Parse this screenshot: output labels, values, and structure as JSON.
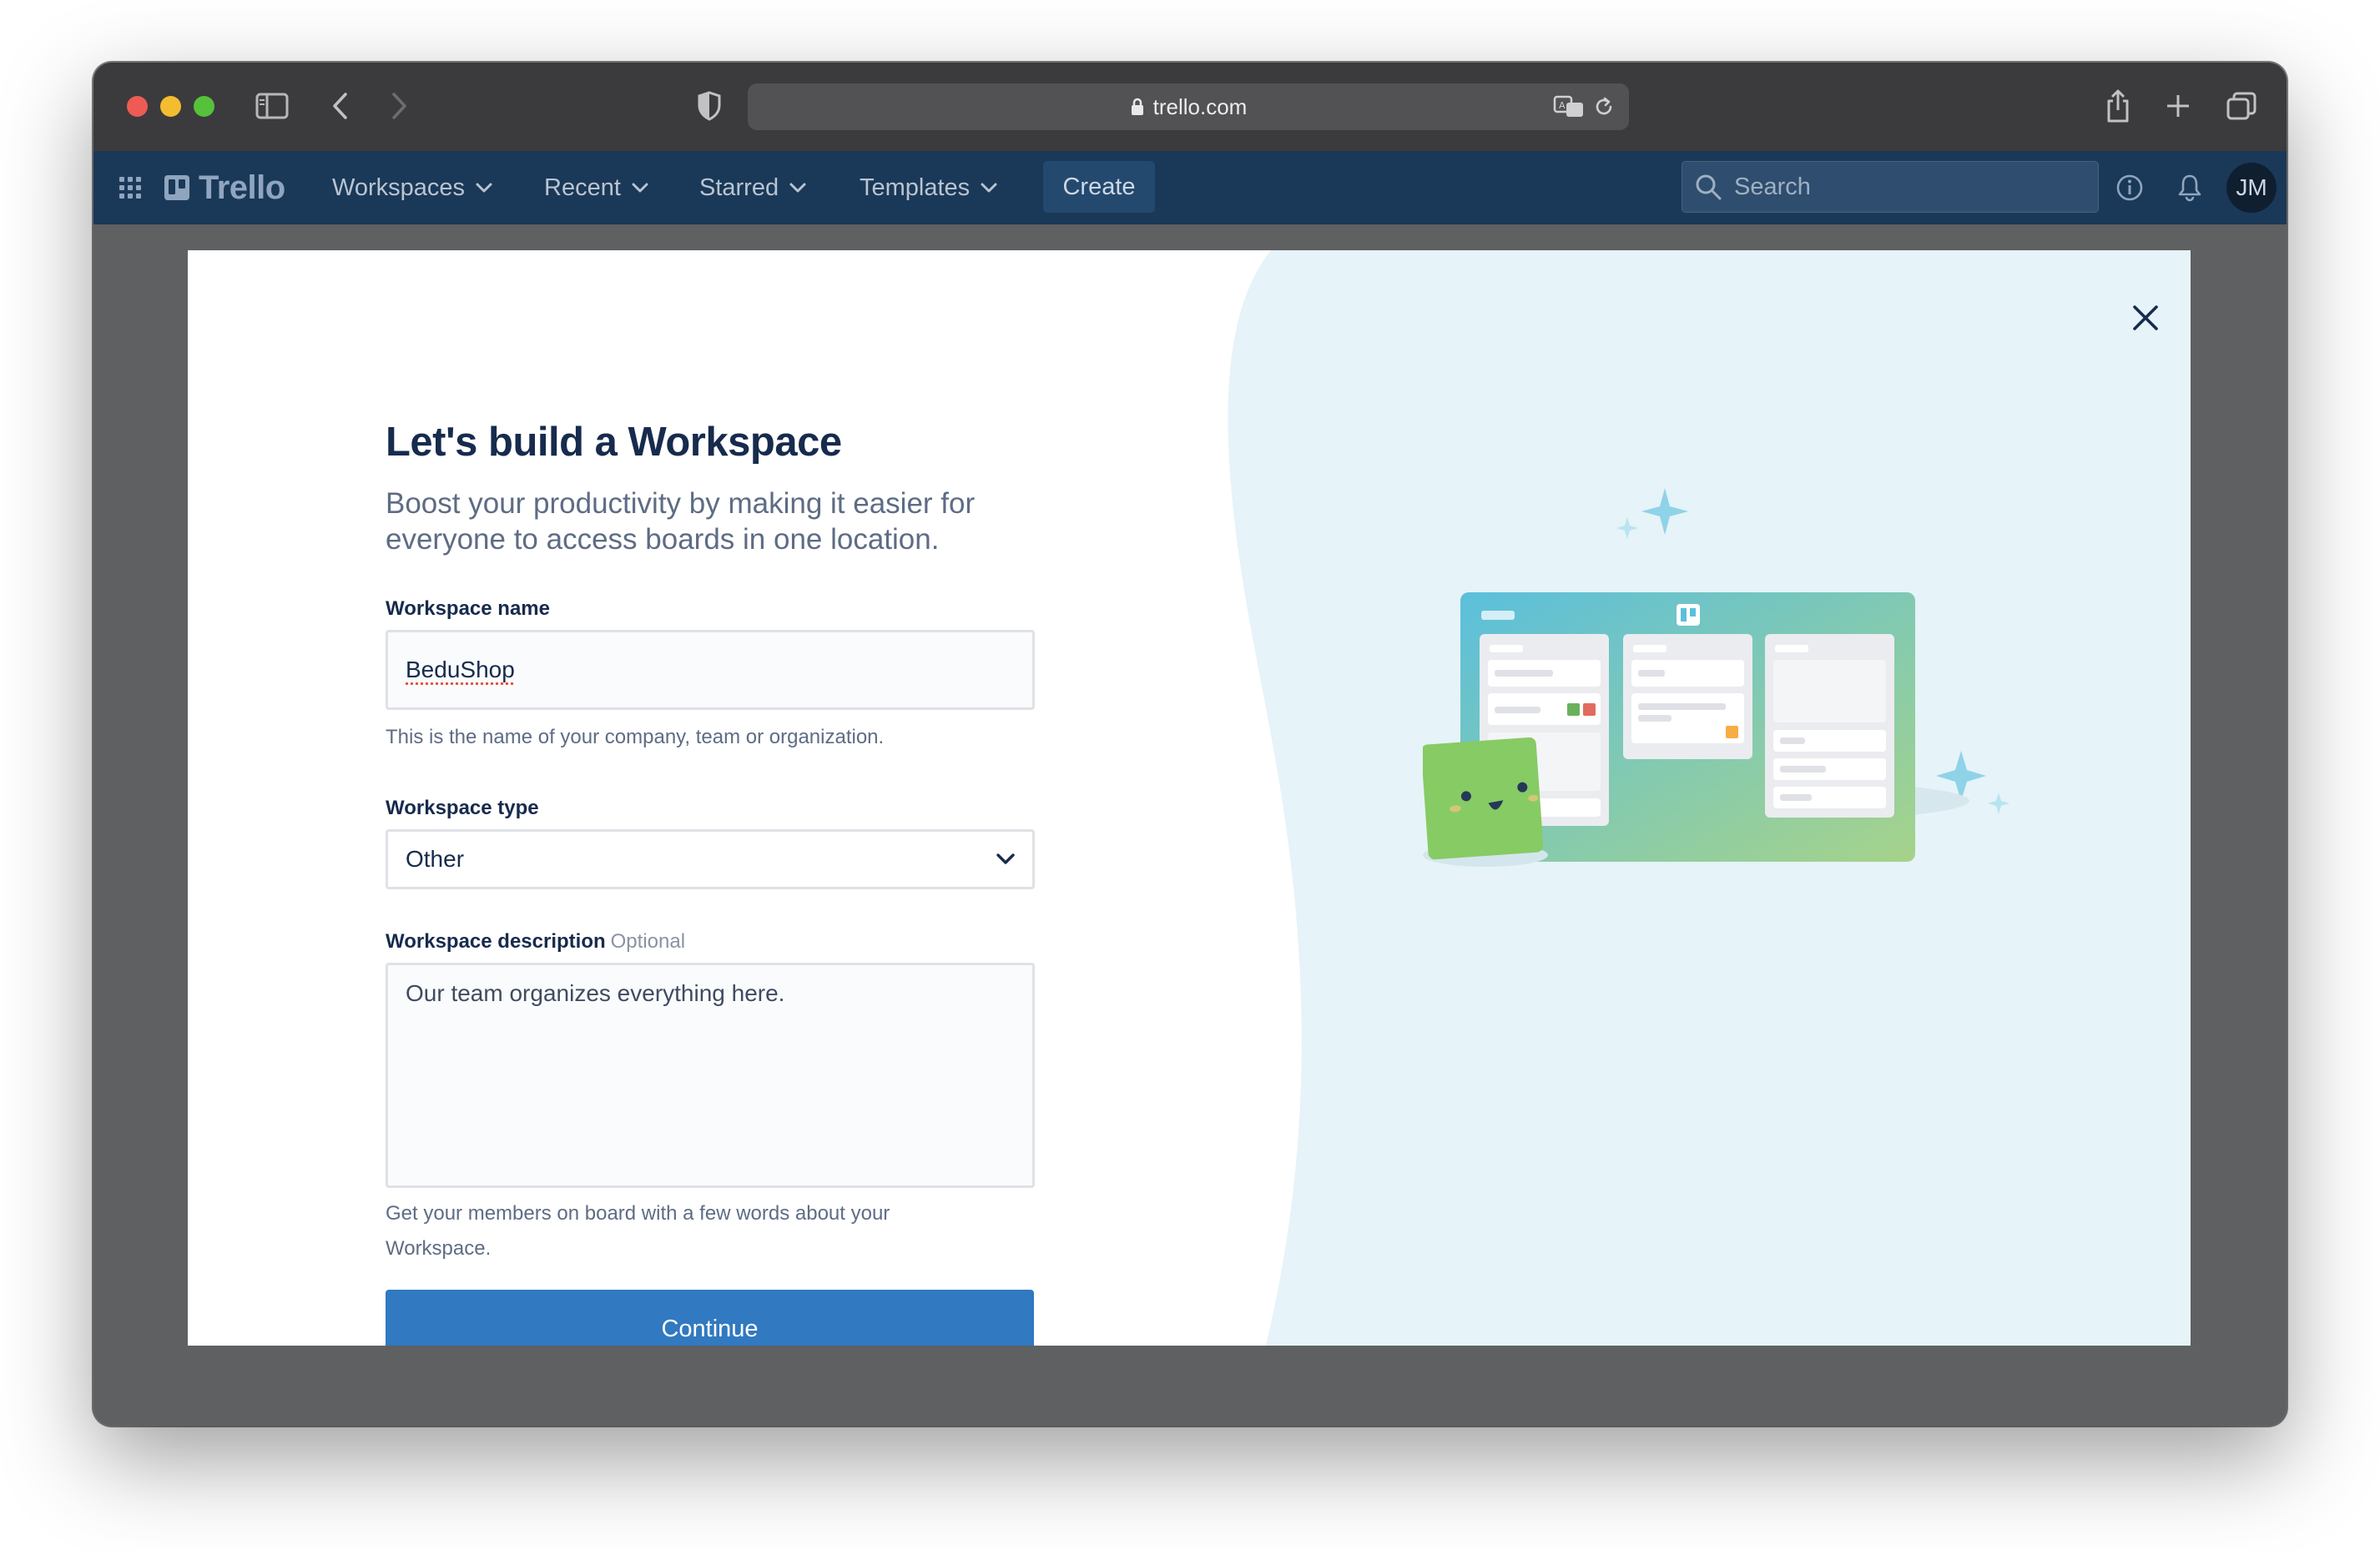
{
  "browser": {
    "url": "trello.com"
  },
  "nav": {
    "logo": "Trello",
    "menus": [
      "Workspaces",
      "Recent",
      "Starred",
      "Templates"
    ],
    "create_label": "Create",
    "search_placeholder": "Search",
    "avatar_initials": "JM"
  },
  "modal": {
    "title": "Let's build a Workspace",
    "subtitle": "Boost your productivity by making it easier for everyone to access boards in one location.",
    "name_label": "Workspace name",
    "name_value": "BeduShop",
    "name_help": "This is the name of your company, team or organization.",
    "type_label": "Workspace type",
    "type_value": "Other",
    "description_label": "Workspace description",
    "description_optional": "Optional",
    "description_value": "Our team organizes everything here.",
    "description_help": "Get your members on board with a few words about your Workspace.",
    "continue_label": "Continue"
  },
  "colors": {
    "navbar": "#1a3858",
    "primary_button": "#3179c0",
    "illustration_bg": "#e6f3f8"
  }
}
